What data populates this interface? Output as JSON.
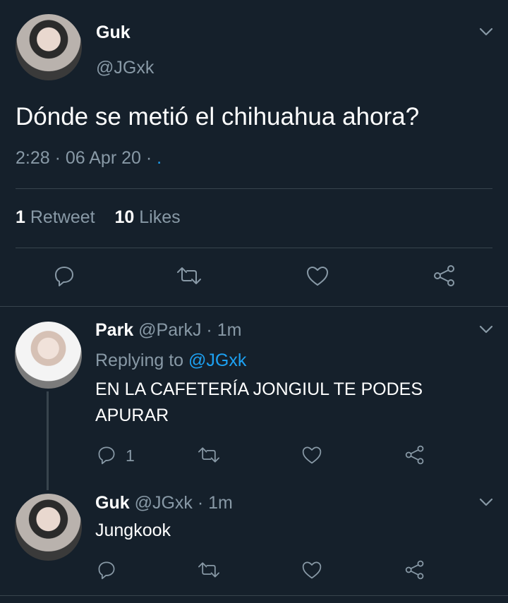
{
  "main_tweet": {
    "name": "Guk",
    "handle": "@JGxk",
    "text": "Dónde se metió el chihuahua ahora?",
    "meta": "2:28 · 06 Apr 20 ·",
    "meta_dot": ".",
    "stats": {
      "retweets_count": "1",
      "retweets_label": "Retweet",
      "likes_count": "10",
      "likes_label": "Likes"
    }
  },
  "replies": [
    {
      "name": "Park",
      "handle": "@ParkJ",
      "time": "· 1m",
      "replying_prefix": "Replying to",
      "replying_handle": "@JGxk",
      "text_line1": "EN LA CAFETERÍA JONGIUL TE PODES",
      "text_line2": "APURAR",
      "reply_count": "1"
    },
    {
      "name": "Guk",
      "handle": "@JGxk",
      "time": "· 1m",
      "text": "Jungkook"
    }
  ],
  "colors": {
    "background": "#15202b",
    "muted": "#8899a6",
    "link": "#1da1f2",
    "divider": "#38444d"
  },
  "icons": [
    "reply-icon",
    "retweet-icon",
    "like-icon",
    "share-icon",
    "chevron-down-icon"
  ]
}
